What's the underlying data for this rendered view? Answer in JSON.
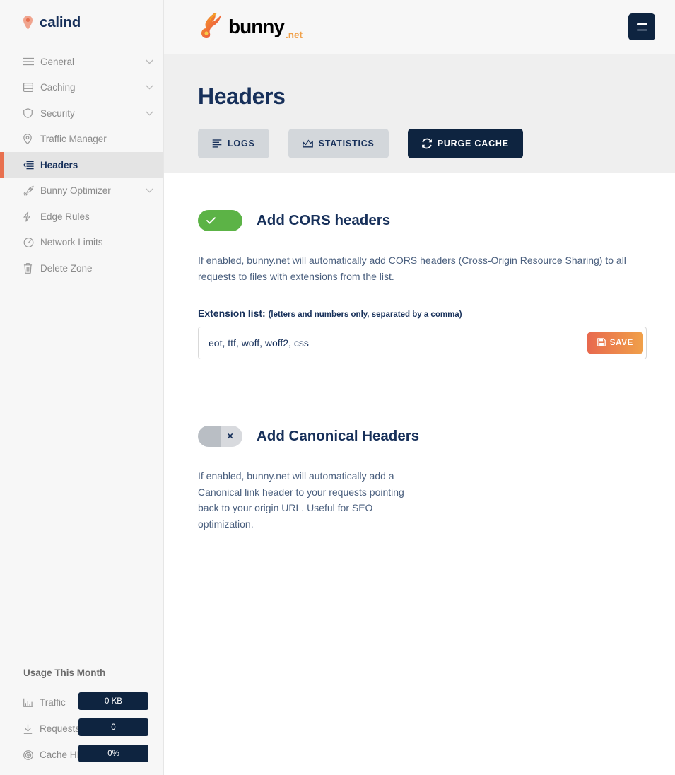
{
  "sidebar": {
    "brand": {
      "name": "calind",
      "icon": "map-pin-icon"
    },
    "items": [
      {
        "label": "General",
        "icon": "menu-lines-icon",
        "expandable": true,
        "active": false
      },
      {
        "label": "Caching",
        "icon": "database-icon",
        "expandable": true,
        "active": false
      },
      {
        "label": "Security",
        "icon": "shield-icon",
        "expandable": true,
        "active": false
      },
      {
        "label": "Traffic Manager",
        "icon": "map-pin-icon",
        "expandable": false,
        "active": false
      },
      {
        "label": "Headers",
        "icon": "headers-icon",
        "expandable": false,
        "active": true
      },
      {
        "label": "Bunny Optimizer",
        "icon": "rocket-icon",
        "expandable": true,
        "active": false
      },
      {
        "label": "Edge Rules",
        "icon": "bolt-icon",
        "expandable": false,
        "active": false
      },
      {
        "label": "Network Limits",
        "icon": "gauge-icon",
        "expandable": false,
        "active": false
      },
      {
        "label": "Delete Zone",
        "icon": "trash-icon",
        "expandable": false,
        "active": false
      }
    ],
    "usage": {
      "title": "Usage This Month",
      "rows": [
        {
          "label": "Traffic",
          "value": "0 KB",
          "icon": "bar-chart-icon"
        },
        {
          "label": "Requests",
          "value": "0",
          "icon": "download-icon"
        },
        {
          "label": "Cache HIT",
          "value": "0%",
          "icon": "target-icon"
        }
      ]
    }
  },
  "topbar": {
    "logo": {
      "text": "bunny",
      "suffix": ".net",
      "icon": "bunny-logo-icon"
    },
    "menu_button": "menu-hamburger-icon"
  },
  "hero": {
    "title": "Headers",
    "buttons": [
      {
        "label": "LOGS",
        "icon": "logs-icon",
        "style": "grey"
      },
      {
        "label": "STATISTICS",
        "icon": "chart-icon",
        "style": "grey"
      },
      {
        "label": "PURGE CACHE",
        "icon": "refresh-icon",
        "style": "dark"
      }
    ]
  },
  "sections": [
    {
      "title": "Add CORS headers",
      "enabled": true,
      "toggle_mark": "✓",
      "description": "If enabled, bunny.net will automatically add CORS headers (Cross-Origin Resource Sharing) to all requests to files with extensions from the list.",
      "field_label": "Extension list:",
      "field_hint": "(letters and numbers only, separated by a comma)",
      "input_value": "eot, ttf, woff, woff2, css",
      "input_placeholder": "",
      "save_label": "SAVE",
      "save_icon": "save-icon"
    },
    {
      "title": "Add Canonical Headers",
      "enabled": false,
      "toggle_mark": "×",
      "description": "If enabled, bunny.net will automatically add a Canonical link header to your requests pointing back to your origin URL. Useful for SEO optimization."
    }
  ],
  "colors": {
    "accent_orange": "#e8704f",
    "navy": "#17305a",
    "dark_navy": "#0e2440",
    "toggle_green": "#5cb346",
    "sidebar_bg": "#f7f7f7",
    "hero_bg": "#efefef"
  }
}
